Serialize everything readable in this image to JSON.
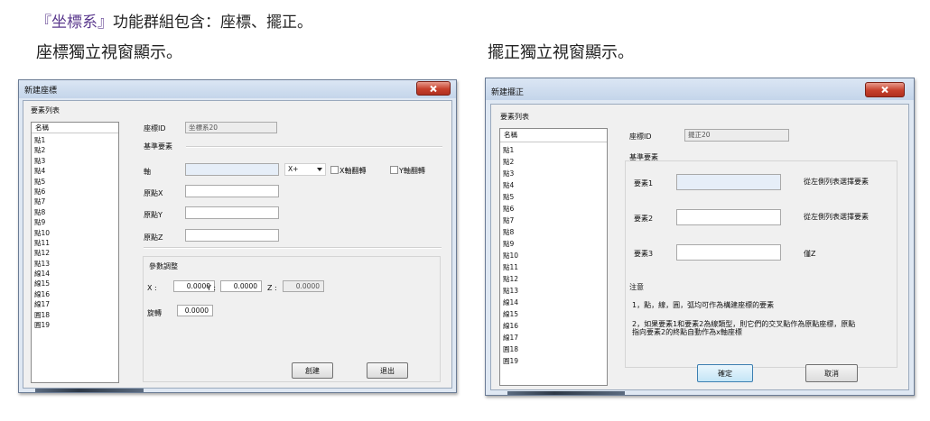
{
  "heading": {
    "open_quote": "『",
    "accent": "坐標系",
    "close_quote": "』",
    "rest": "功能群組包含：座標、擺正。"
  },
  "captions": {
    "left": "座標獨立視窗顯示。",
    "right": "擺正獨立視窗顯示。"
  },
  "coord_dialog": {
    "title": "新建座標",
    "list_label": "要素列表",
    "list_header": "名稱",
    "items": [
      "點1",
      "點2",
      "點3",
      "點4",
      "點5",
      "點6",
      "點7",
      "點8",
      "點9",
      "點10",
      "點11",
      "點12",
      "點13",
      "線14",
      "線15",
      "線16",
      "線17",
      "圓18",
      "圓19"
    ],
    "id_label": "座標ID",
    "id_value": "坐標系20",
    "basis_label": "基準要素",
    "axis_label": "軸",
    "axis_select": "X+",
    "x_flip_label": "X軸翻轉",
    "y_flip_label": "Y軸翻轉",
    "origin_x_label": "原點X",
    "origin_y_label": "原點Y",
    "origin_z_label": "原點Z",
    "param_label": "參數調整",
    "x_label": "X :",
    "x_value": "0.0000",
    "y_label": "Y :",
    "y_value": "0.0000",
    "z_label": "Z :",
    "z_value": "0.0000",
    "rotate_label": "旋轉",
    "rotate_value": "0.0000",
    "create_button": "創建",
    "exit_button": "退出"
  },
  "align_dialog": {
    "title": "新建擺正",
    "list_label": "要素列表",
    "list_header": "名稱",
    "items": [
      "點1",
      "點2",
      "點3",
      "點4",
      "點5",
      "點6",
      "點7",
      "點8",
      "點9",
      "點10",
      "點11",
      "點12",
      "點13",
      "線14",
      "線15",
      "線16",
      "線17",
      "圓18",
      "圓19"
    ],
    "id_label": "座標ID",
    "id_value": "擺正20",
    "basis_label": "基準要素",
    "elem1_label": "要素1",
    "elem1_hint": "從左側列表選擇要素",
    "elem2_label": "要素2",
    "elem2_hint": "從左側列表選擇要素",
    "elem3_label": "要素3",
    "elem3_hint": "僅Z",
    "note_title": "注意",
    "note1": "1，點，線，圓，弧均可作為構建座標的要素",
    "note2a": "2，如果要素1和要素2為線類型，則它們的交叉點作為原點座標，原點",
    "note2b": "指向要素2的終點自動作為x軸座標",
    "ok_button": "確定",
    "cancel_button": "取消"
  },
  "colors": {
    "accent": "#5b3a8e",
    "close": "#c7402c",
    "titlebar": "#c4d5ea"
  }
}
